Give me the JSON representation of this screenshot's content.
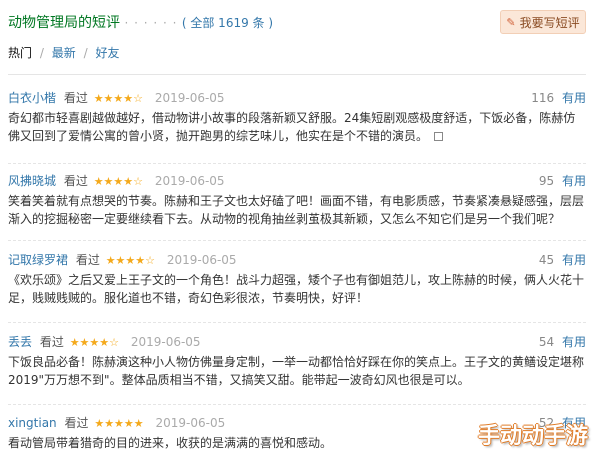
{
  "header": {
    "title": "动物管理局的短评",
    "dots": "· · · · · ·",
    "count": "( 全部 1619 条 )",
    "write_button": "我要写短评",
    "write_icon": "pencil-icon"
  },
  "tabs": {
    "hot": "热门",
    "latest": "最新",
    "friends": "好友",
    "separator": "/"
  },
  "reviews": [
    {
      "user": "白衣小楷",
      "status": "看过",
      "stars": "★★★★☆",
      "rating": 4,
      "date": "2019-06-05",
      "votes": "116",
      "useful": "有用",
      "text": "奇幻都市轻喜剧越做越好，借动物讲小故事的段落新颖又舒服。24集短剧观感极度舒适，下饭必备，陈赫仿佛又回到了爱情公寓的曾小贤，抛开跑男的综艺味儿，他实在是个不错的演员。"
    },
    {
      "user": "风拂晓城",
      "status": "看过",
      "stars": "★★★★☆",
      "rating": 4,
      "date": "2019-06-05",
      "votes": "95",
      "useful": "有用",
      "text": "笑着笑着就有点想哭的节奏。陈赫和王子文也太好磕了吧！画面不错，有电影质感，节奏紧凑悬疑感强，层层渐入的挖掘秘密一定要继续看下去。从动物的视角抽丝剥茧极其新颖，又怎么不知它们是另一个我们呢？"
    },
    {
      "user": "记取绿罗裙",
      "status": "看过",
      "stars": "★★★★☆",
      "rating": 4,
      "date": "2019-06-05",
      "votes": "45",
      "useful": "有用",
      "text": "《欢乐颂》之后又爱上王子文的一个角色！战斗力超强，矮个子也有御姐范儿，攻上陈赫的时候，俩人火花十足，贱贼贱贼的。服化道也不错，奇幻色彩很浓，节奏明快，好评！"
    },
    {
      "user": "丢丢",
      "status": "看过",
      "stars": "★★★★☆",
      "rating": 4,
      "date": "2019-06-05",
      "votes": "54",
      "useful": "有用",
      "text": "下饭良品必备！陈赫演这种小人物仿佛量身定制，一举一动都恰恰好踩在你的笑点上。王子文的黄鳝设定堪称2019\"万万想不到\"。整体品质相当不错，又搞笑又甜。能带起一波奇幻风也很是可以。"
    },
    {
      "user": "xingtian",
      "status": "看过",
      "stars": "★★★★★",
      "rating": 5,
      "date": "2019-06-05",
      "votes": "52",
      "useful": "有用",
      "text": "看动管局带着猎奇的目的进来，收获的是满满的喜悦和感动。"
    }
  ],
  "watermark": "手动动手游",
  "colors": {
    "title_green": "#007722",
    "link_blue": "#3377aa",
    "star_orange": "#f4a91b"
  }
}
